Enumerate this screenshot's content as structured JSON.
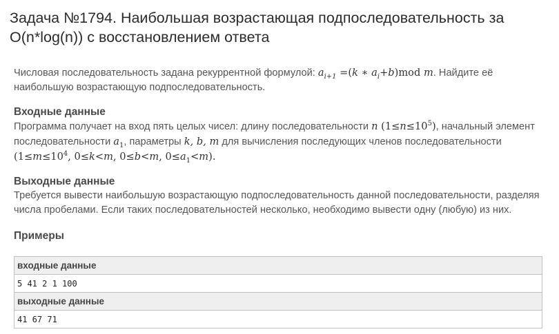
{
  "problem": {
    "title": "Задача №1794. Наибольшая возрастающая подпоследовательность за O(n*log(n)) с восстановлением ответа"
  },
  "statement": {
    "text_before_formula": "Числовая последовательность задана рекуррентной формулой: ",
    "formula": {
      "a": "a",
      "i_plus_1": "i+1",
      "eq": " =(",
      "k": "k",
      "star": " ∗ ",
      "i": "i",
      "plus": "+",
      "b": "b",
      "mod": ")mod ",
      "m": "m"
    },
    "text_after_formula": ". Найдите её наибольшую возрастающую подпоследовательность."
  },
  "input_section": {
    "heading": "Входные данные",
    "text_1": "Программа получает на вход пять целых чисел: длину последовательности ",
    "n": "n",
    "constraint_n_open": " (1≤",
    "constraint_n_base": "≤10",
    "constraint_n_exp": "5",
    "constraint_n_close": ")",
    "text_2": ", начальный элемент последовательности ",
    "a1_base": "a",
    "a1_sub": "1",
    "text_3": ", параметры ",
    "params": "k, b, m",
    "text_4": " для вычисления последующих членов последовательности ",
    "constraints": {
      "m_open": "(1≤",
      "m_var": "m",
      "m_rest": "≤10",
      "m_exp": "4",
      "k_prefix": ", 0≤",
      "k_var": "k",
      "k_rest": "<",
      "m2": "m",
      "b_prefix": ", 0≤",
      "b_var": "b",
      "b_rest": "<",
      "m3": "m",
      "a_prefix": ", 0≤",
      "a_var": "a",
      "a_sub": "1",
      "a_rest": "<",
      "m4": "m",
      "close": ")."
    }
  },
  "output_section": {
    "heading": "Выходные данные",
    "text": "Требуется вывести наибольшую возрастающую подпоследовательность данной последовательности, разделяя числа пробелами. Если таких последовательностей несколько, необходимо вывести одну (любую) из них."
  },
  "examples": {
    "heading": "Примеры",
    "input_label": "входные данные",
    "input_value": "5 41 2 1 100",
    "output_label": "выходные данные",
    "output_value": "41 67 71"
  }
}
